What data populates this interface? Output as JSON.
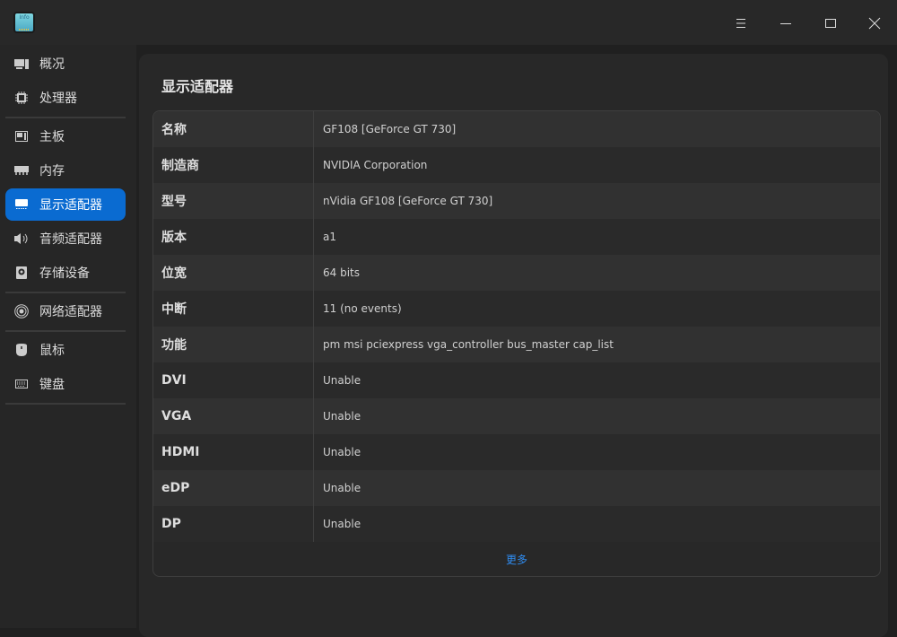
{
  "app": {
    "icon_text": "Info"
  },
  "window_controls": {
    "menu": "menu-icon",
    "minimize": "minimize-icon",
    "maximize": "maximize-icon",
    "close": "close-icon"
  },
  "sidebar": {
    "items": [
      {
        "label": "概况",
        "icon": "overview-icon"
      },
      {
        "label": "处理器",
        "icon": "cpu-icon"
      },
      {
        "label": "主板",
        "icon": "motherboard-icon"
      },
      {
        "label": "内存",
        "icon": "memory-icon"
      },
      {
        "label": "显示适配器",
        "icon": "display-adapter-icon",
        "active": true
      },
      {
        "label": "音频适配器",
        "icon": "speaker-icon"
      },
      {
        "label": "存储设备",
        "icon": "storage-icon"
      },
      {
        "label": "网络适配器",
        "icon": "network-icon"
      },
      {
        "label": "鼠标",
        "icon": "mouse-icon"
      },
      {
        "label": "键盘",
        "icon": "keyboard-icon"
      }
    ]
  },
  "main": {
    "title": "显示适配器",
    "rows": [
      {
        "key": "名称",
        "value": "GF108 [GeForce GT 730]"
      },
      {
        "key": "制造商",
        "value": "NVIDIA Corporation"
      },
      {
        "key": "型号",
        "value": "nVidia GF108 [GeForce GT 730]"
      },
      {
        "key": "版本",
        "value": "a1"
      },
      {
        "key": "位宽",
        "value": "64 bits"
      },
      {
        "key": "中断",
        "value": "11 (no events)"
      },
      {
        "key": "功能",
        "value": "pm msi pciexpress vga_controller bus_master cap_list"
      },
      {
        "key": "DVI",
        "value": "Unable"
      },
      {
        "key": "VGA",
        "value": "Unable"
      },
      {
        "key": "HDMI",
        "value": "Unable"
      },
      {
        "key": "eDP",
        "value": "Unable"
      },
      {
        "key": "DP",
        "value": "Unable"
      }
    ],
    "more_label": "更多"
  },
  "colors": {
    "accent": "#0a6bd1",
    "link": "#2f8cf0"
  }
}
